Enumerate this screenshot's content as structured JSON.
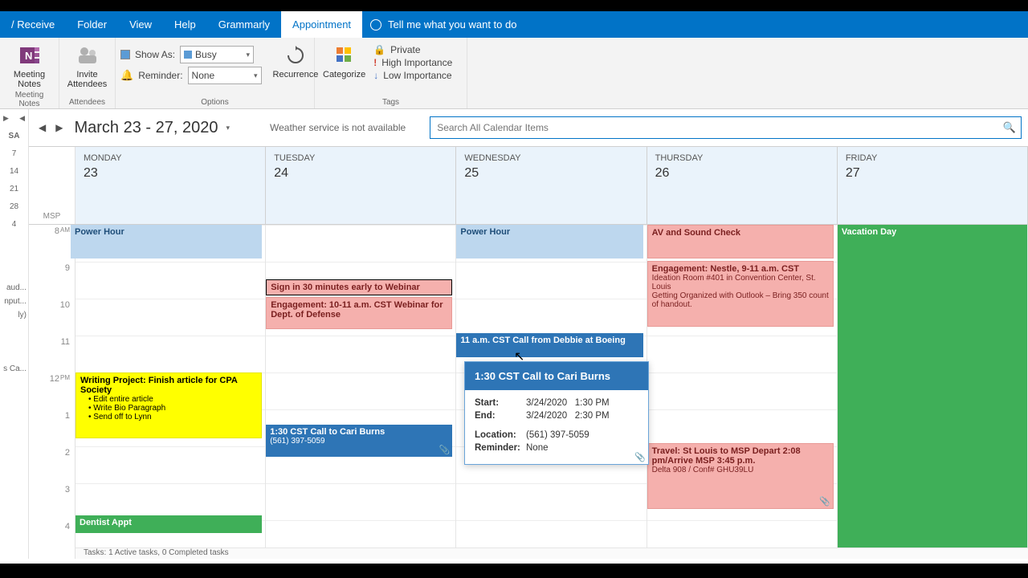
{
  "ribbon": {
    "tabs": [
      "/ Receive",
      "Folder",
      "View",
      "Help",
      "Grammarly",
      "Appointment"
    ],
    "active_tab": "Appointment",
    "tellme": "Tell me what you want to do",
    "meeting_notes": "Meeting Notes",
    "meeting_notes_group": "Meeting Notes",
    "invite_attendees": "Invite Attendees",
    "attendees_group": "Attendees",
    "show_as_label": "Show As:",
    "show_as_value": "Busy",
    "reminder_label": "Reminder:",
    "reminder_value": "None",
    "recurrence": "Recurrence",
    "categorize": "Categorize",
    "options_group": "Options",
    "tags_group": "Tags",
    "private": "Private",
    "high_importance": "High Importance",
    "low_importance": "Low Importance"
  },
  "left_edge": {
    "sa": "SA",
    "nums": [
      "7",
      "14",
      "21",
      "28",
      "4"
    ],
    "extras": [
      "aud...",
      "nput...",
      "ly)",
      "s Ca..."
    ]
  },
  "cal": {
    "date_range": "March 23 - 27, 2020",
    "weather": "Weather service is not available",
    "search_placeholder": "Search All Calendar Items",
    "msp": "MSP",
    "days": [
      {
        "name": "MONDAY",
        "num": "23"
      },
      {
        "name": "TUESDAY",
        "num": "24"
      },
      {
        "name": "WEDNESDAY",
        "num": "25"
      },
      {
        "name": "THURSDAY",
        "num": "26"
      },
      {
        "name": "FRIDAY",
        "num": "27"
      }
    ],
    "hours": [
      "8",
      "9",
      "10",
      "11",
      "12",
      "1",
      "2",
      "3",
      "4"
    ],
    "ampm": [
      "AM",
      "",
      "",
      "",
      "PM",
      "",
      "",
      "",
      ""
    ],
    "tasks_footer": "Tasks: 1 Active tasks, 0 Completed tasks"
  },
  "events": {
    "mon_power": "Power Hour",
    "mon_writing_title": "Writing Project: Finish article for CPA Society",
    "mon_writing_b1": "Edit entire article",
    "mon_writing_b2": "Write Bio Paragraph",
    "mon_writing_b3": "Send off to Lynn",
    "mon_dentist": "Dentist Appt",
    "tue_signin": "Sign in 30 minutes early to Webinar",
    "tue_engage": "Engagement: 10-11 a.m. CST Webinar for Dept. of Defense",
    "tue_call_title": "1:30 CST Call to Cari Burns",
    "tue_call_sub": "(561) 397-5059",
    "wed_power": "Power Hour",
    "wed_boeing": "11 a.m. CST Call from Debbie at Boeing",
    "thu_av": "AV and Sound Check",
    "thu_eng_title": "Engagement: Nestle, 9-11 a.m. CST",
    "thu_eng_l1": "Ideation Room #401 in Convention Center, St. Louis",
    "thu_eng_l2": "Getting Organized with Outlook – Bring 350 count of handout.",
    "thu_travel_title": "Travel: St Louis  to MSP  Depart 2:08 pm/Arrive MSP 3:45 p.m.",
    "thu_travel_sub": "Delta 908 / Conf# GHU39LU",
    "fri_vacation": "Vacation Day"
  },
  "tooltip": {
    "title": "1:30 CST Call to Cari Burns",
    "start_label": "Start:",
    "start_date": "3/24/2020",
    "start_time": "1:30 PM",
    "end_label": "End:",
    "end_date": "3/24/2020",
    "end_time": "2:30 PM",
    "location_label": "Location:",
    "location_value": "(561) 397-5059",
    "reminder_label": "Reminder:",
    "reminder_value": "None"
  }
}
